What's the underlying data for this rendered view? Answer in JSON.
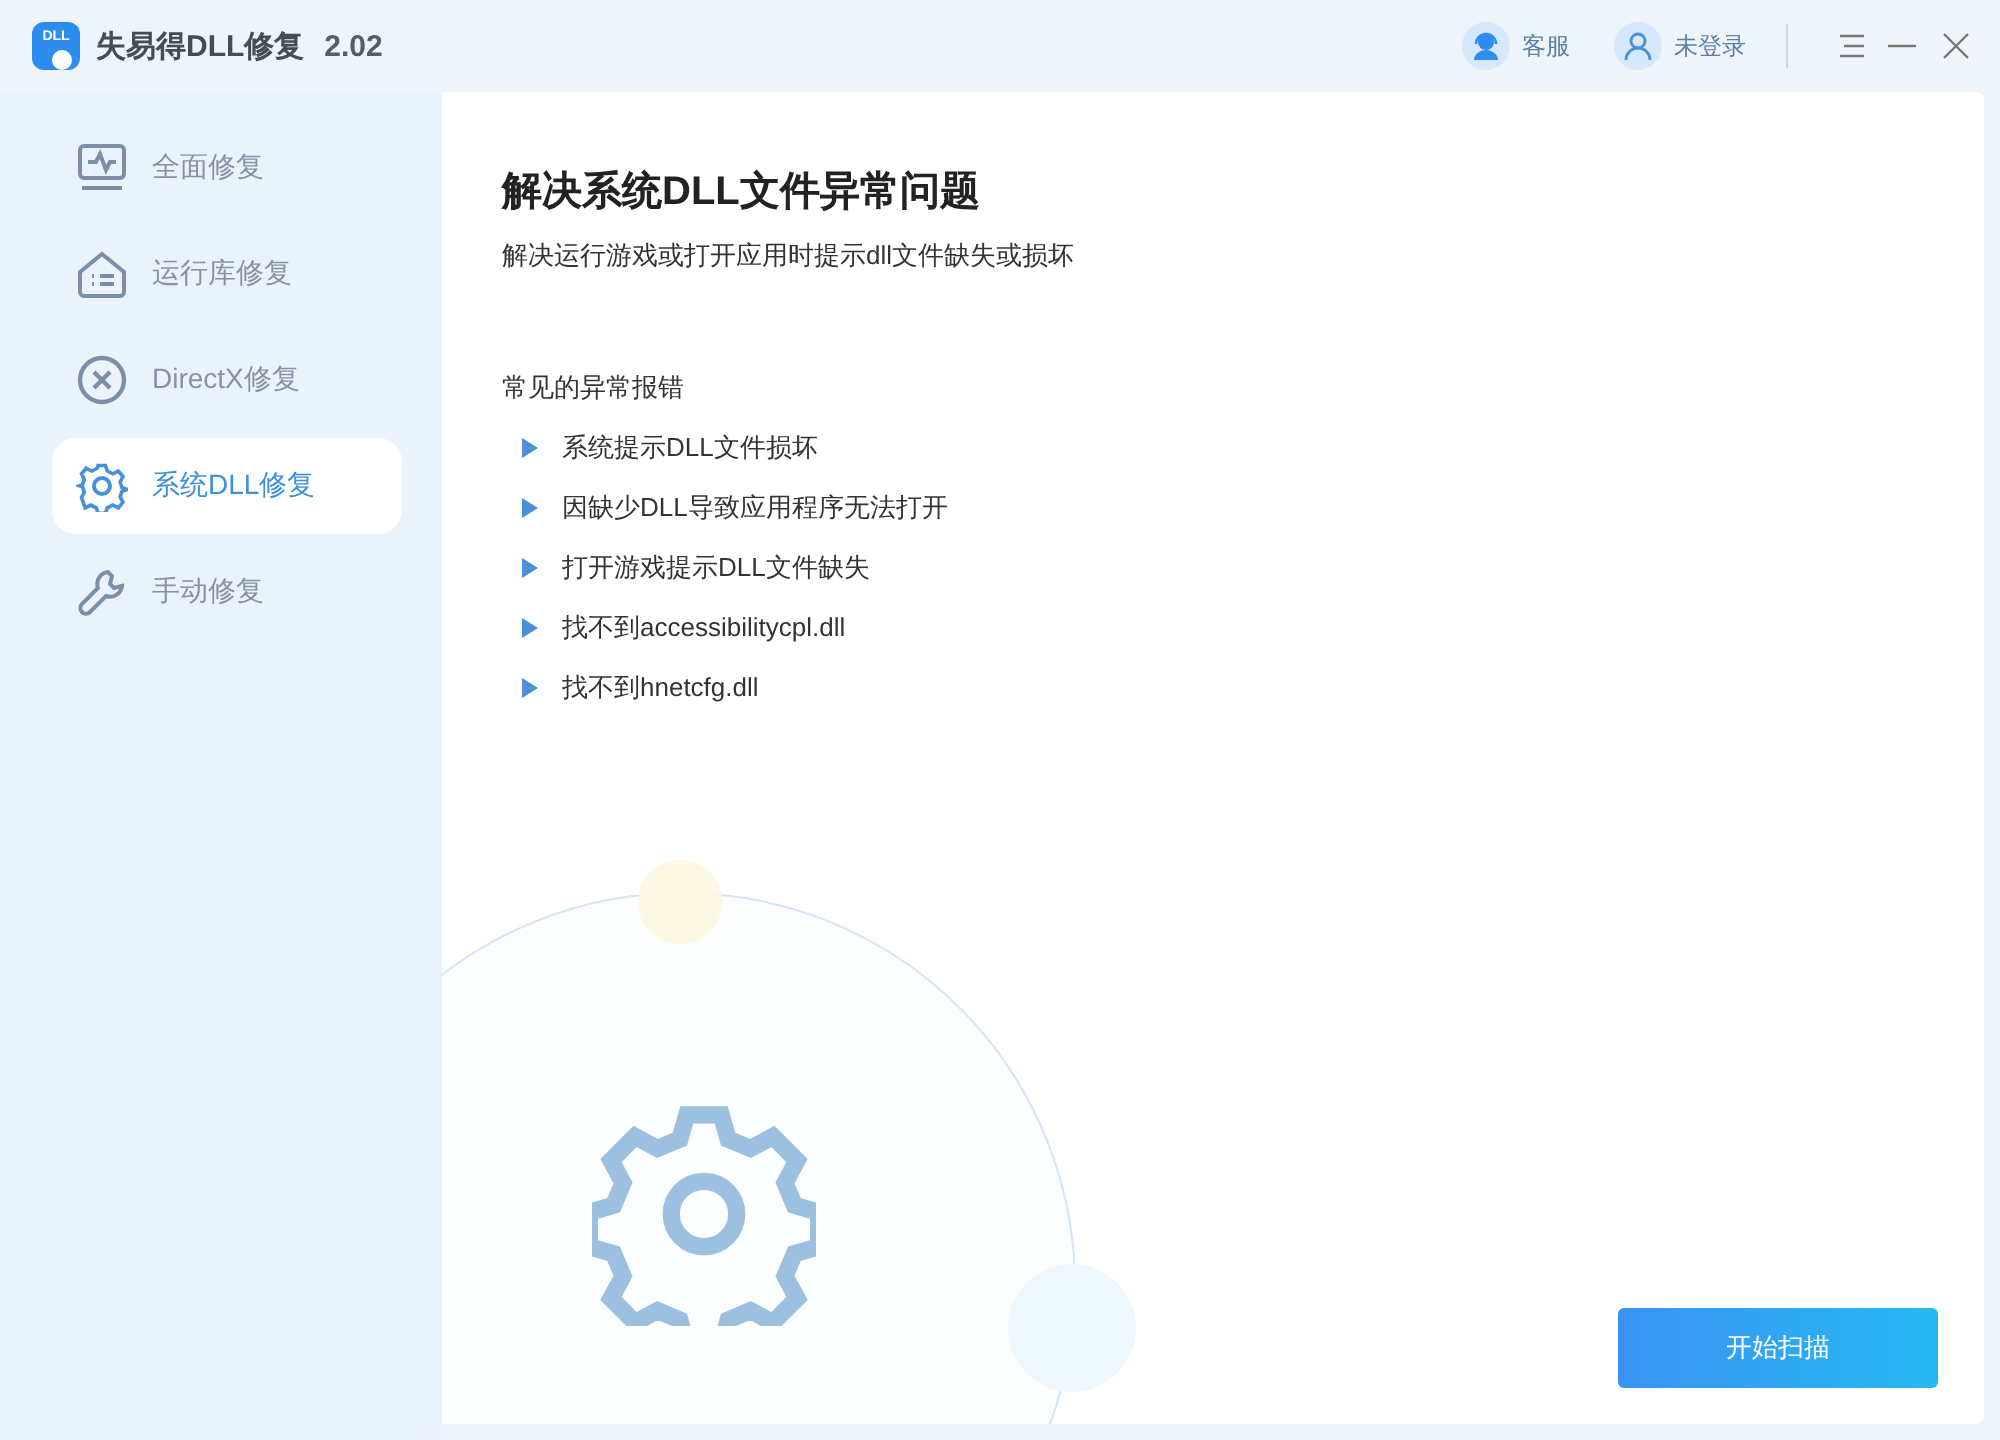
{
  "window": {
    "logo_text": "DLL",
    "title": "失易得DLL修复",
    "version": "2.02"
  },
  "header": {
    "service": "客服",
    "login": "未登录"
  },
  "sidebar": {
    "items": [
      {
        "label": "全面修复",
        "kind": "monitor",
        "selected": false
      },
      {
        "label": "运行库修复",
        "kind": "library",
        "selected": false
      },
      {
        "label": "DirectX修复",
        "kind": "cross",
        "selected": false
      },
      {
        "label": "系统DLL修复",
        "kind": "gear",
        "selected": true
      },
      {
        "label": "手动修复",
        "kind": "wrench",
        "selected": false
      }
    ]
  },
  "content": {
    "title": "解决系统DLL文件异常问题",
    "subtitle": "解决运行游戏或打开应用时提示dll文件缺失或损坏",
    "section": "常见的异常报错",
    "errors": [
      "系统提示DLL文件损坏",
      "因缺少DLL导致应用程序无法打开",
      "打开游戏提示DLL文件缺失",
      "找不到accessibilitycpl.dll",
      "找不到hnetcfg.dll"
    ],
    "button": "开始扫描"
  }
}
